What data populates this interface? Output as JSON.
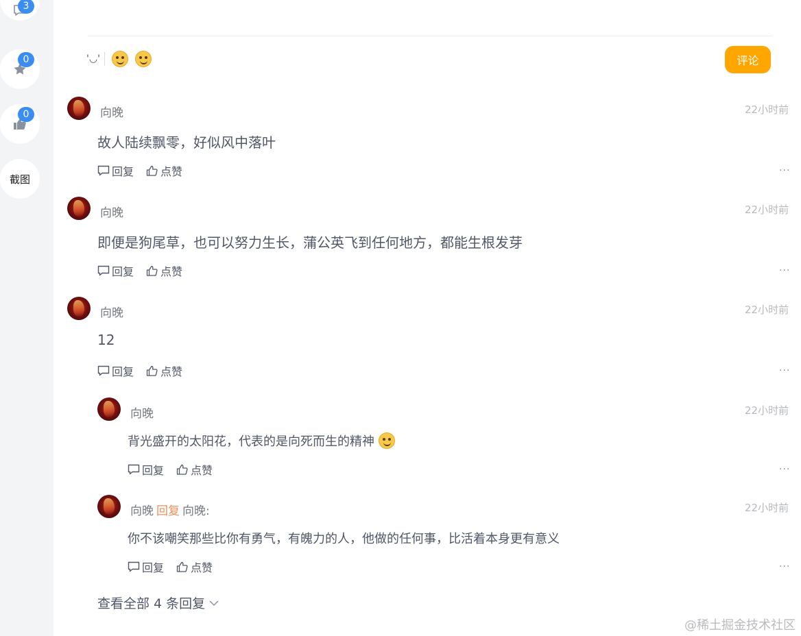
{
  "sidebar": {
    "comments_badge": "3",
    "favorites_badge": "0",
    "likes_badge": "0",
    "screenshot_label": "截图"
  },
  "editor": {
    "kaomoji": "'◡'",
    "submit_label": "评论"
  },
  "actions": {
    "reply_label": "回复",
    "like_label": "点赞",
    "more_label": "..."
  },
  "comments": [
    {
      "user": "向晚",
      "time": "22小时前",
      "text": "故人陆续飘零，好似风中落叶"
    },
    {
      "user": "向晚",
      "time": "22小时前",
      "text": "即便是狗尾草，也可以努力生长，蒲公英飞到任何地方，都能生根发芽"
    },
    {
      "user": "向晚",
      "time": "22小时前",
      "text": "12"
    }
  ],
  "replies": [
    {
      "user": "向晚",
      "time": "22小时前",
      "text": "背光盛开的太阳花，代表的是向死而生的精神"
    },
    {
      "user": "向晚",
      "reply_tag": "回复",
      "reply_to": "向晚:",
      "time": "22小时前",
      "text": "你不该嘲笑那些比你有勇气，有魄力的人，他做的任何事，比活着本身更有意义"
    }
  ],
  "view_all_label": "查看全部 4 条回复",
  "watermark": "@稀土掘金技术社区"
}
